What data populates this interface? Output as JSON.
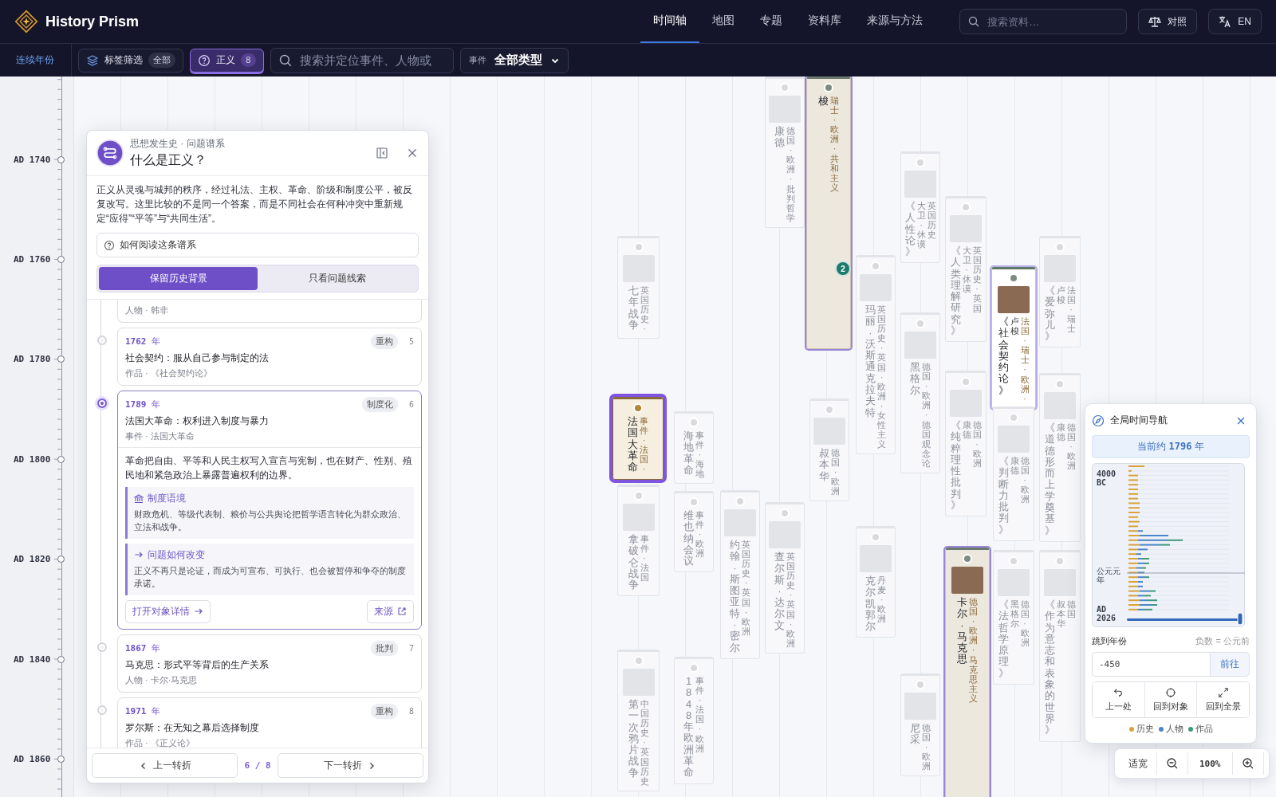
{
  "app": {
    "name": "History Prism"
  },
  "nav": [
    {
      "label": "时间轴",
      "selected": true
    },
    {
      "label": "地图",
      "selected": false
    },
    {
      "label": "专题",
      "selected": false
    },
    {
      "label": "资料库",
      "selected": false
    },
    {
      "label": "来源与方法",
      "selected": false
    }
  ],
  "header_search": {
    "placeholder": "搜索资料…"
  },
  "header_buttons": [
    {
      "kind": "compare",
      "label": "对照"
    },
    {
      "kind": "language",
      "label": "EN"
    }
  ],
  "toolbar": {
    "scale_label": "连续年份",
    "tag_filter": {
      "label": "标签筛选",
      "value": "全部"
    },
    "topic": {
      "label": "正义",
      "count": "8",
      "selected": true
    },
    "search": {
      "placeholder": "搜索并定位事件、人物或"
    },
    "type_filter": {
      "label": "事件",
      "value": "全部类型"
    }
  },
  "year_axis": [
    "AD 1740",
    "AD 1760",
    "AD 1780",
    "AD 1800",
    "AD 1820",
    "AD 1840",
    "AD 1860"
  ],
  "canvas_cards": [
    {
      "kind": "event",
      "title": "七年战争",
      "meta": "英国历史 ·",
      "photo": true,
      "dimmed": true,
      "selected": false
    },
    {
      "kind": "event",
      "title": "法国大革命",
      "meta": "事件 · 法国 ·",
      "photo": false,
      "dimmed": false,
      "selected": true
    },
    {
      "kind": "event",
      "title": "拿破仑战争",
      "meta": "事件 · 法国",
      "photo": true,
      "dimmed": true,
      "selected": false
    },
    {
      "kind": "event",
      "title": "第一次鸦片战争",
      "meta": "中国历史 · 英国历史",
      "photo": true,
      "dimmed": true,
      "selected": false
    },
    {
      "kind": "event",
      "title": "海地革命",
      "meta": "事件 · 海地",
      "photo": false,
      "dimmed": true,
      "selected": false
    },
    {
      "kind": "event",
      "title": "维也纳会议",
      "meta": "事件 · 欧洲",
      "photo": false,
      "dimmed": true,
      "selected": false
    },
    {
      "kind": "event",
      "title": "1848年欧洲革命",
      "meta": "事件 · 法国 · 欧洲",
      "photo": false,
      "dimmed": true,
      "selected": false
    },
    {
      "kind": "person",
      "title": "约翰 · 斯图亚特 · 密尔",
      "meta": "英国历史 · 英国 · 欧洲",
      "photo": true,
      "dimmed": true,
      "selected": false
    },
    {
      "kind": "person",
      "title": "康德",
      "meta": "德国 · 欧洲 · 批判哲学",
      "photo": true,
      "dimmed": true,
      "selected": false
    },
    {
      "kind": "person",
      "title": "查尔斯 · 达尔文",
      "meta": "英国历史 · 英国 · 欧洲",
      "photo": true,
      "dimmed": true,
      "selected": false
    },
    {
      "kind": "person",
      "title": "梭",
      "meta": "瑞士 · 欧洲 · 共和主义",
      "photo": false,
      "dimmed": false,
      "selected": false,
      "badge": "2"
    },
    {
      "kind": "person",
      "title": "叔本华",
      "meta": "德国 · 欧洲",
      "photo": true,
      "dimmed": true,
      "selected": false
    },
    {
      "kind": "person",
      "title": "玛丽 · 沃斯通克拉夫特",
      "meta": "英国历史 · 英国 · 欧洲 · 女性主义",
      "photo": true,
      "dimmed": true,
      "selected": false
    },
    {
      "kind": "person",
      "title": "克尔凯郭尔",
      "meta": "丹麦 · 欧洲",
      "photo": true,
      "dimmed": true,
      "selected": false
    },
    {
      "kind": "work",
      "title": "《人性论》",
      "author": "大卫 · 休谟",
      "meta": "英国历史",
      "photo": true,
      "dimmed": true,
      "selected": false
    },
    {
      "kind": "person",
      "title": "黑格尔",
      "meta": "德国 · 欧洲 · 德国观念论",
      "photo": true,
      "dimmed": true,
      "selected": false
    },
    {
      "kind": "person",
      "title": "尼采",
      "meta": "德国 · 欧洲",
      "photo": true,
      "dimmed": true,
      "selected": false
    },
    {
      "kind": "work",
      "title": "《人类理解研究》",
      "author": "大卫 · 休谟",
      "meta": "英国历史 · 英国",
      "photo": true,
      "dimmed": true,
      "selected": false
    },
    {
      "kind": "work",
      "title": "《纯粹理性批判》",
      "author": "康德",
      "meta": "德国 · 欧洲",
      "photo": true,
      "dimmed": true,
      "selected": false
    },
    {
      "kind": "person",
      "title": "卡尔 · 马克思",
      "meta": "德国 · 欧洲 · 马克思主义",
      "photo": true,
      "dimmed": false,
      "selected": false
    },
    {
      "kind": "work",
      "title": "《社会契约论》",
      "author": "卢梭",
      "meta": "法国 · 瑞士 · 欧洲 ·",
      "photo": true,
      "dimmed": false,
      "selected": false
    },
    {
      "kind": "work",
      "title": "《判断力批判》",
      "author": "康德",
      "meta": "德国 · 欧洲",
      "photo": true,
      "dimmed": true,
      "selected": false
    },
    {
      "kind": "work",
      "title": "《法哲学原理》",
      "author": "黑格尔",
      "meta": "德国 · 欧洲",
      "photo": true,
      "dimmed": true,
      "selected": false
    },
    {
      "kind": "work",
      "title": "《爱弥儿》",
      "author": "卢梭",
      "meta": "法国 · 瑞士",
      "photo": true,
      "dimmed": true,
      "selected": false
    },
    {
      "kind": "work",
      "title": "《道德形而上学奠基》",
      "author": "康德",
      "meta": "德国 · 欧洲",
      "photo": true,
      "dimmed": true,
      "selected": false
    },
    {
      "kind": "work",
      "title": "《作为意志和表象的世界》",
      "author": "叔本华",
      "meta": "德国",
      "photo": true,
      "dimmed": true,
      "selected": false
    }
  ],
  "question_panel": {
    "subtitle": "思想发生史 · 问题谱系",
    "title": "什么是正义？",
    "description": "正义从灵魂与城邦的秩序，经过礼法、主权、革命、阶级和制度公平，被反复改写。这里比较的不是同一个答案，而是不同社会在何种冲突中重新规定“应得”“平等”与“共同生活”。",
    "reading_guide": "如何阅读这条谱系",
    "modes": [
      {
        "label": "保留历史背景",
        "selected": true
      },
      {
        "label": "只看问题线索",
        "selected": false
      }
    ],
    "partial_meta": "人物 · 韩非",
    "turns": [
      {
        "year": "1762",
        "unit": "年",
        "tag": "重构",
        "index": "5",
        "title": "社会契约：服从自己参与制定的法",
        "meta": "作品 · 《社会契约论》",
        "selected": false,
        "expanded": false
      },
      {
        "year": "1789",
        "unit": "年",
        "tag": "制度化",
        "index": "6",
        "title": "法国大革命：权利进入制度与暴力",
        "meta": "事件 · 法国大革命",
        "selected": true,
        "expanded": true,
        "body": "革命把自由、平等和人民主权写入宣言与宪制，也在财产、性别、殖民地和紧急政治上暴露普遍权利的边界。",
        "context": {
          "heading": "制度语境",
          "text": "财政危机、等级代表制、粮价与公共舆论把哲学语言转化为群众政治、立法和战争。"
        },
        "change": {
          "heading": "问题如何改变",
          "text": "正义不再只是论证，而成为可宣布、可执行、也会被暂停和争夺的制度承诺。"
        },
        "open_label": "打开对象详情",
        "source_label": "来源"
      },
      {
        "year": "1867",
        "unit": "年",
        "tag": "批判",
        "index": "7",
        "title": "马克思：形式平等背后的生产关系",
        "meta": "人物 · 卡尔·马克思",
        "selected": false,
        "expanded": false
      },
      {
        "year": "1971",
        "unit": "年",
        "tag": "重构",
        "index": "8",
        "title": "罗尔斯：在无知之幕后选择制度",
        "meta": "作品 · 《正义论》",
        "selected": false,
        "expanded": false
      }
    ],
    "footer": {
      "prev": "上一转折",
      "position": "6 / 8",
      "next": "下一转折"
    }
  },
  "navigator": {
    "title": "全局时间导航",
    "current_prefix": "当前约",
    "current_year": "1796",
    "current_suffix": "年",
    "minimap_labels": [
      "4000 BC",
      "公元元年",
      "AD 2026"
    ],
    "jump_label": "跳到年份",
    "jump_hint": "负数 = 公元前",
    "jump_value": "-450",
    "go_label": "前往",
    "actions": [
      {
        "kind": "back",
        "label": "上一处"
      },
      {
        "kind": "target",
        "label": "回到对象"
      },
      {
        "kind": "overview",
        "label": "回到全景"
      }
    ],
    "legend": [
      {
        "label": "历史",
        "color": "#d9a23a"
      },
      {
        "label": "人物",
        "color": "#4a86c8"
      },
      {
        "label": "作品",
        "color": "#3f9a78"
      }
    ]
  },
  "zoom_bar": {
    "fit_label": "适宽",
    "zoom": "100%"
  }
}
